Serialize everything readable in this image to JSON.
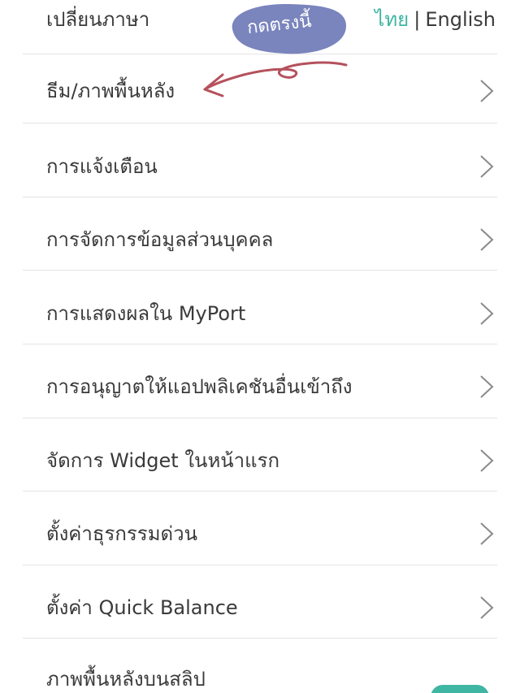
{
  "language": {
    "label": "เปลี่ยนภาษา",
    "thai": "ไทย",
    "separator": "|",
    "english": "English"
  },
  "annotation": {
    "text": "กดตรงนี้"
  },
  "menu": {
    "items": [
      {
        "label": "ธีม/ภาพพื้นหลัง"
      },
      {
        "label": "การแจ้งเตือน"
      },
      {
        "label": "การจัดการข้อมูลส่วนบุคคล"
      },
      {
        "label": "การแสดงผลใน MyPort"
      },
      {
        "label": "การอนุญาตให้แอปพลิเคชันอื่นเข้าถึง"
      },
      {
        "label": "จัดการ Widget ในหน้าแรก"
      },
      {
        "label": "ตั้งค่าธุรกรรมด่วน"
      },
      {
        "label": "ตั้งค่า Quick Balance"
      }
    ],
    "slip_background": {
      "label": "ภาพพื้นหลังบนสลิป"
    }
  },
  "colors": {
    "accent": "#3fb5a3",
    "annotation_blob": "#7a84bd",
    "annotation_arrow": "#b5515c",
    "divider": "#e4e4e4",
    "text": "#3a3a3a"
  }
}
